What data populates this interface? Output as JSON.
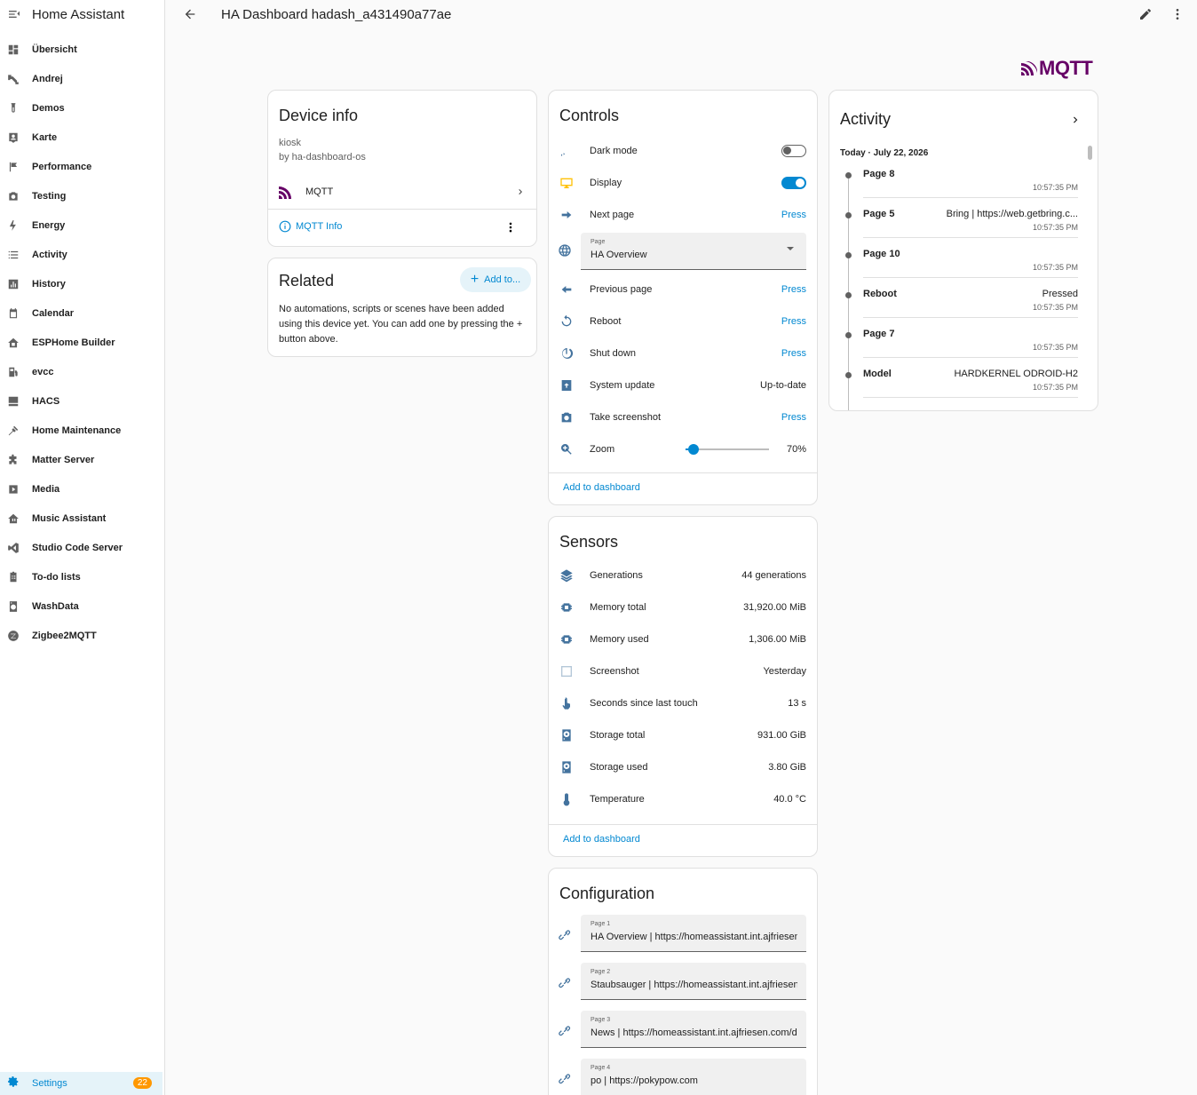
{
  "app_title": "Home Assistant",
  "page_title": "HA Dashboard hadash_a431490a77ae",
  "sidebar": {
    "items": [
      {
        "label": "Übersicht",
        "icon": "view-dashboard-icon"
      },
      {
        "label": "Andrej",
        "icon": "pipe-icon"
      },
      {
        "label": "Demos",
        "icon": "test-tube-icon"
      },
      {
        "label": "Karte",
        "icon": "map-account-icon"
      },
      {
        "label": "Performance",
        "icon": "flag-icon"
      },
      {
        "label": "Testing",
        "icon": "camera-icon"
      },
      {
        "label": "Energy",
        "icon": "lightning-icon"
      },
      {
        "label": "Activity",
        "icon": "format-list-icon"
      },
      {
        "label": "History",
        "icon": "chart-box-icon"
      },
      {
        "label": "Calendar",
        "icon": "calendar-icon"
      },
      {
        "label": "ESPHome Builder",
        "icon": "home-chip-icon"
      },
      {
        "label": "evcc",
        "icon": "ev-station-icon"
      },
      {
        "label": "HACS",
        "icon": "hacs-icon"
      },
      {
        "label": "Home Maintenance",
        "icon": "tools-icon"
      },
      {
        "label": "Matter Server",
        "icon": "puzzle-icon"
      },
      {
        "label": "Media",
        "icon": "play-box-icon"
      },
      {
        "label": "Music Assistant",
        "icon": "music-home-icon"
      },
      {
        "label": "Studio Code Server",
        "icon": "vscode-icon"
      },
      {
        "label": "To-do lists",
        "icon": "clipboard-list-icon"
      },
      {
        "label": "WashData",
        "icon": "washing-machine-icon"
      },
      {
        "label": "Zigbee2MQTT",
        "icon": "zigbee-icon"
      }
    ],
    "settings_label": "Settings",
    "settings_badge": "22"
  },
  "mqtt_logo_text": "MQTT",
  "device_info": {
    "title": "Device info",
    "model": "kiosk",
    "manufacturer": "by ha-dashboard-os",
    "integration": "MQTT",
    "info_link": "MQTT Info"
  },
  "related": {
    "title": "Related",
    "add_label": "Add to...",
    "text": "No automations, scripts or scenes have been added using this device yet. You can add one by pressing the + button above."
  },
  "controls": {
    "title": "Controls",
    "rows": [
      {
        "name": "Dark mode",
        "type": "toggle",
        "state": "off",
        "icon": "theme-light-dark-icon"
      },
      {
        "name": "Display",
        "type": "toggle",
        "state": "on",
        "icon": "monitor-icon"
      },
      {
        "name": "Next page",
        "type": "button",
        "value": "Press",
        "icon": "arrow-right-icon"
      },
      {
        "name": "Page",
        "type": "select",
        "value": "HA Overview",
        "icon": "web-icon"
      },
      {
        "name": "Previous page",
        "type": "button",
        "value": "Press",
        "icon": "arrow-left-icon"
      },
      {
        "name": "Reboot",
        "type": "button",
        "value": "Press",
        "icon": "restart-icon"
      },
      {
        "name": "Shut down",
        "type": "button",
        "value": "Press",
        "icon": "power-icon"
      },
      {
        "name": "System update",
        "type": "text",
        "value": "Up-to-date",
        "icon": "package-up-icon"
      },
      {
        "name": "Take screenshot",
        "type": "button",
        "value": "Press",
        "icon": "camera-icon"
      },
      {
        "name": "Zoom",
        "type": "slider",
        "value": "70%",
        "level": 0.1,
        "icon": "magnify-plus-icon"
      }
    ],
    "add_to_dashboard": "Add to dashboard"
  },
  "sensors": {
    "title": "Sensors",
    "rows": [
      {
        "name": "Generations",
        "value": "44 generations",
        "icon": "layers-icon"
      },
      {
        "name": "Memory total",
        "value": "31,920.00 MiB",
        "icon": "memory-icon"
      },
      {
        "name": "Memory used",
        "value": "1,306.00 MiB",
        "icon": "memory-icon"
      },
      {
        "name": "Screenshot",
        "value": "Yesterday",
        "icon": "screenshot-thumbnail-icon"
      },
      {
        "name": "Seconds since last touch",
        "value": "13 s",
        "icon": "gesture-tap-icon"
      },
      {
        "name": "Storage total",
        "value": "931.00 GiB",
        "icon": "harddisk-icon"
      },
      {
        "name": "Storage used",
        "value": "3.80 GiB",
        "icon": "harddisk-icon"
      },
      {
        "name": "Temperature",
        "value": "40.0 °C",
        "icon": "thermometer-icon"
      }
    ],
    "add_to_dashboard": "Add to dashboard"
  },
  "configuration": {
    "title": "Configuration",
    "rows": [
      {
        "label": "Page 1",
        "value": "HA Overview | https://homeassistant.int.ajfriesen.",
        "icon": "link-icon"
      },
      {
        "label": "Page 2",
        "value": "Staubsauger | https://homeassistant.int.ajfriesen.",
        "icon": "link-icon"
      },
      {
        "label": "Page 3",
        "value": "News | https://homeassistant.int.ajfriesen.com/da",
        "icon": "link-icon"
      },
      {
        "label": "Page 4",
        "value": "po | https://pokypow.com",
        "icon": "link-icon"
      }
    ]
  },
  "activity": {
    "title": "Activity",
    "date": "Today · July 22, 2026",
    "entries": [
      {
        "name": "Page 8",
        "message": "",
        "time": "10:57:35 PM"
      },
      {
        "name": "Page 5",
        "message": "Bring | https://web.getbring.c...",
        "time": "10:57:35 PM"
      },
      {
        "name": "Page 10",
        "message": "",
        "time": "10:57:35 PM"
      },
      {
        "name": "Reboot",
        "message": "Pressed",
        "time": "10:57:35 PM"
      },
      {
        "name": "Page 7",
        "message": "",
        "time": "10:57:35 PM"
      },
      {
        "name": "Model",
        "message": "HARDKERNEL ODROID-H2",
        "time": "10:57:35 PM"
      }
    ]
  },
  "colors": {
    "accent": "#0288d1",
    "icon": "#44739e",
    "mqtt": "#660066",
    "badge": "#ff9800"
  }
}
